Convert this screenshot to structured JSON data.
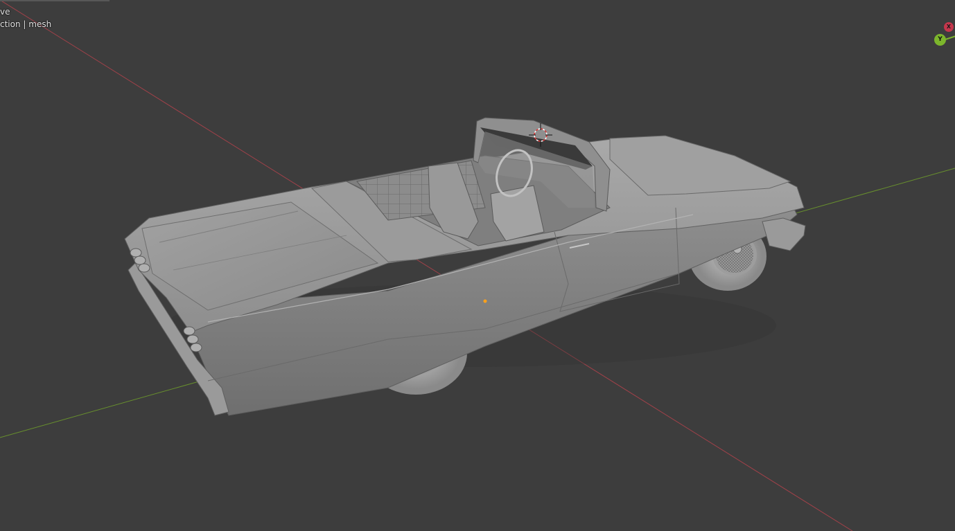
{
  "viewport": {
    "view_mode_text": "ve",
    "collection_text": "ction | mesh",
    "background_color": "#3d3d3d"
  },
  "axes": {
    "x_axis_color": "#b2424c",
    "y_axis_color": "#6d9a2c"
  },
  "gizmo": {
    "x_label": "X",
    "y_label": "Y",
    "x_color": "#c5364c",
    "y_color": "#7cb62c"
  },
  "scene": {
    "object": "mesh",
    "model": "convertible lowrider car",
    "shading": "solid"
  },
  "icons": [
    "3d-cursor-icon",
    "origin-point-icon",
    "navigation-gizmo-icon"
  ]
}
